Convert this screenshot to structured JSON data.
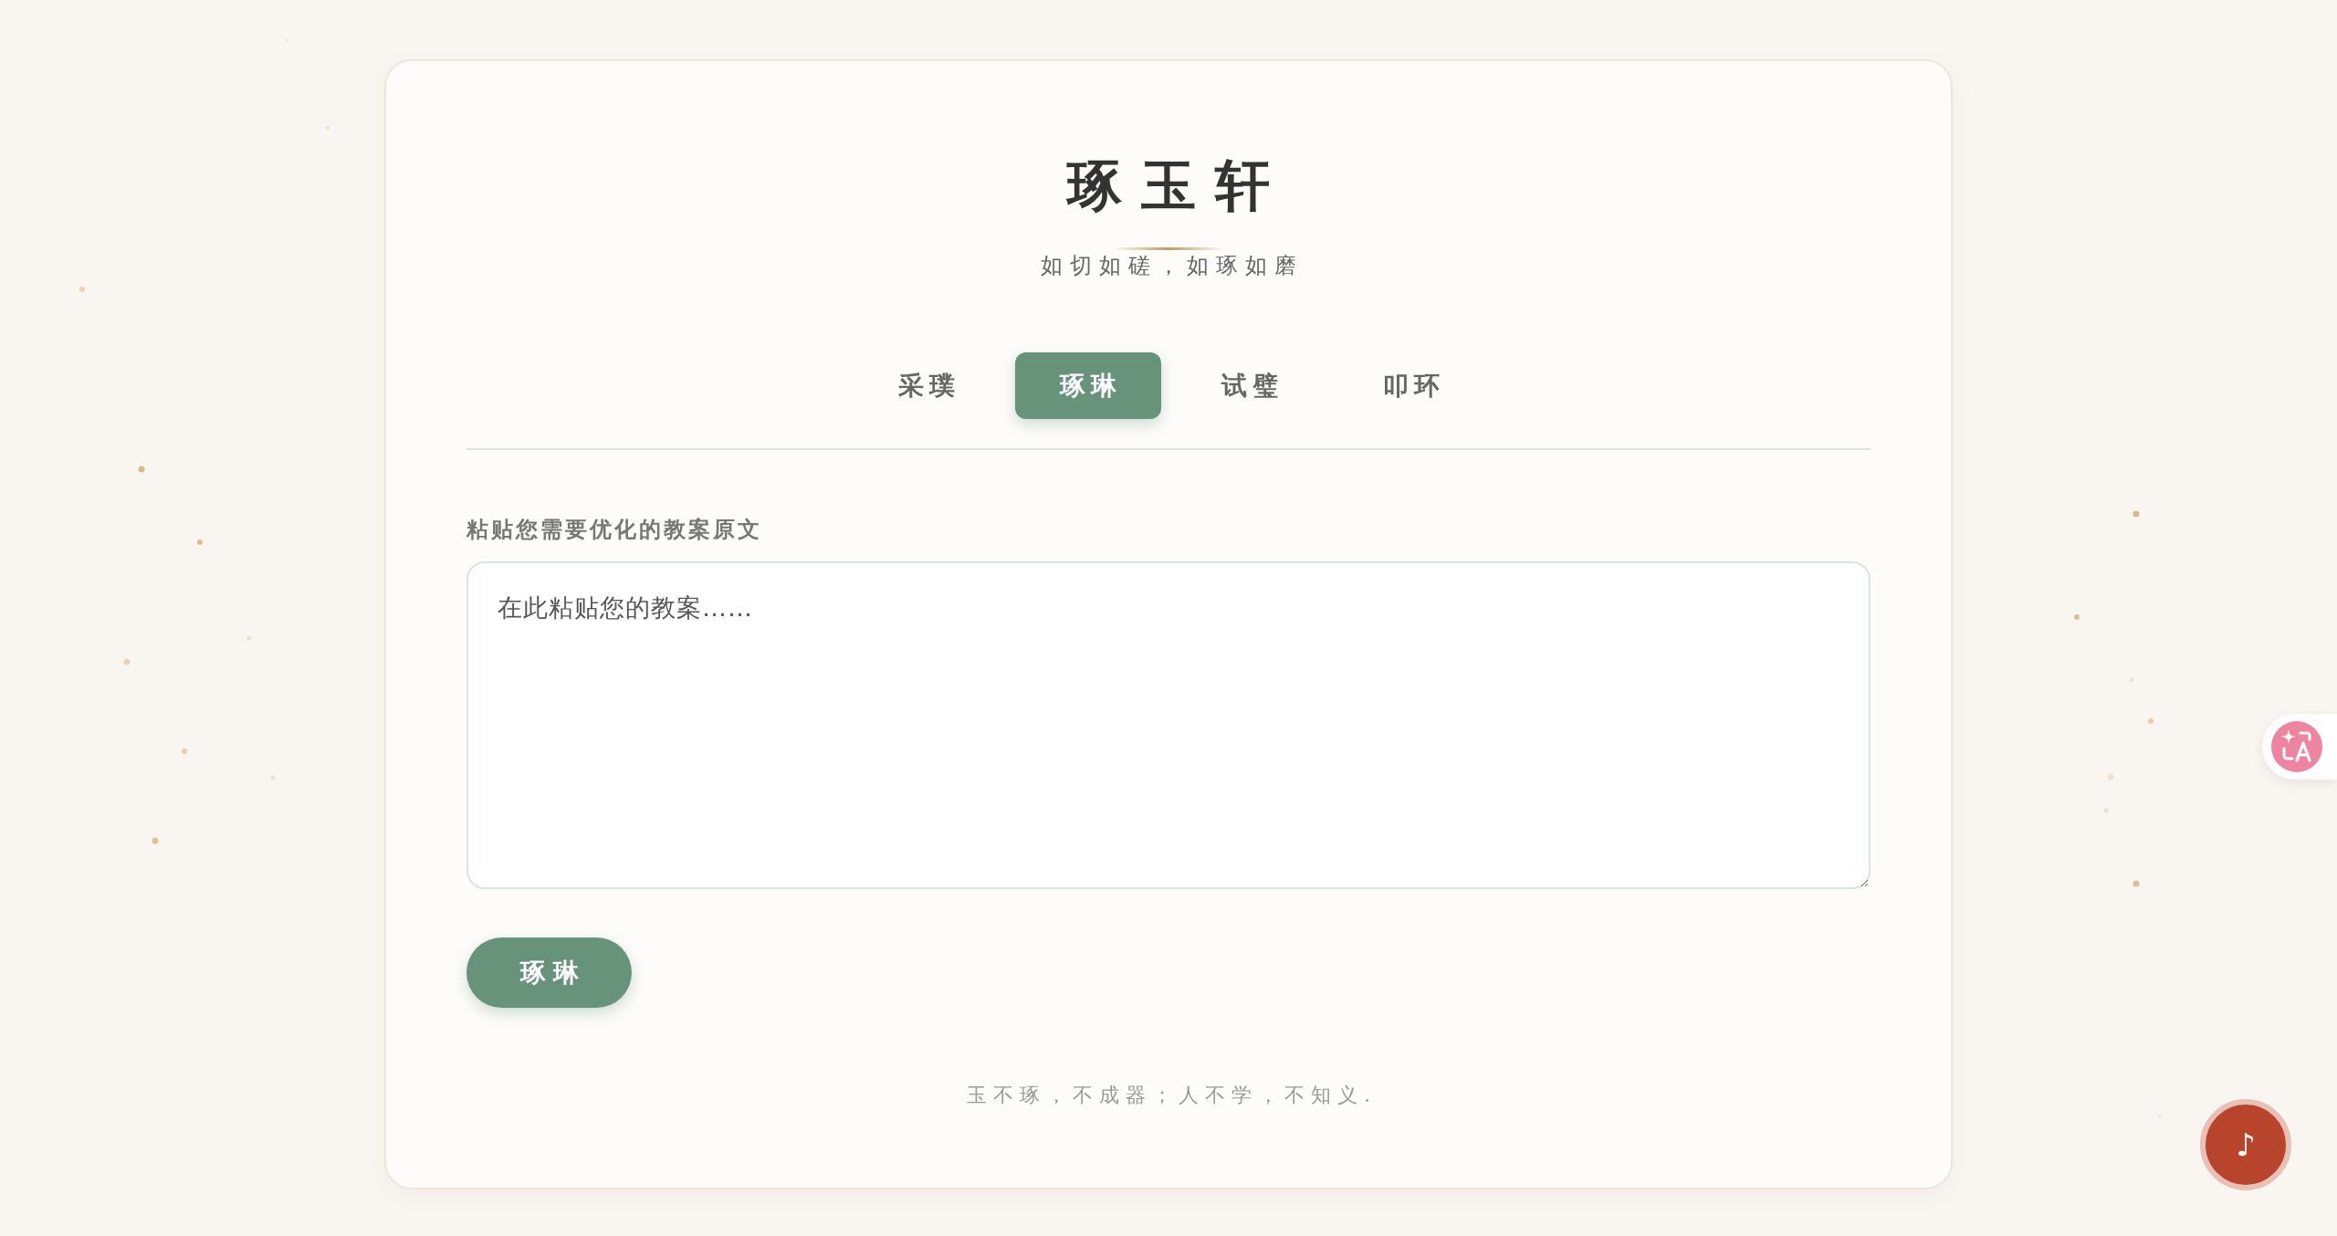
{
  "header": {
    "title": "琢玉轩",
    "subtitle": "如切如磋，如琢如磨"
  },
  "tabs": [
    {
      "label": "采璞",
      "selected": false
    },
    {
      "label": "琢琳",
      "selected": true
    },
    {
      "label": "试璧",
      "selected": false
    },
    {
      "label": "叩环",
      "selected": false
    }
  ],
  "form": {
    "label": "粘贴您需要优化的教案原文",
    "placeholder": "在此粘贴您的教案……",
    "submit": "琢琳"
  },
  "footer": {
    "quote": "玉不琢，不成器；人不学，不知义."
  },
  "music_button": {
    "label": "♪"
  }
}
